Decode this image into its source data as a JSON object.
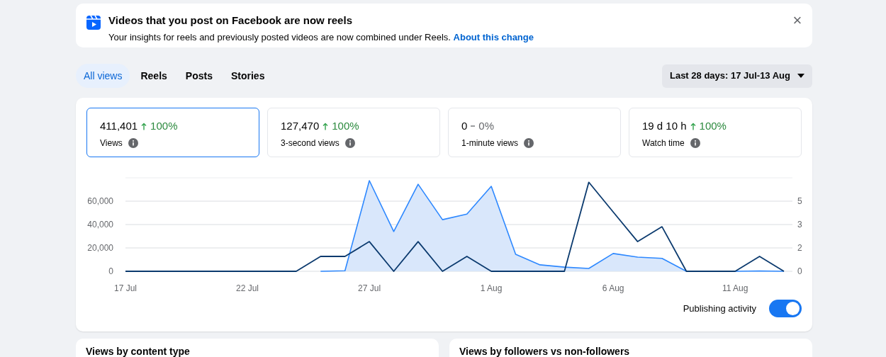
{
  "banner": {
    "title": "Videos that you post on Facebook are now reels",
    "text": "Your insights for reels and previously posted videos are now combined under Reels.",
    "link": "About this change",
    "close": "×"
  },
  "tabs": [
    {
      "label": "All views",
      "selected": true
    },
    {
      "label": "Reels",
      "selected": false
    },
    {
      "label": "Posts",
      "selected": false
    },
    {
      "label": "Stories",
      "selected": false
    }
  ],
  "date_range": {
    "label": "Last 28 days: 17 Jul-13 Aug"
  },
  "metrics": [
    {
      "value": "411,401",
      "kind": "up",
      "change": "100%",
      "label": "Views",
      "selected": true
    },
    {
      "value": "127,470",
      "kind": "up",
      "change": "100%",
      "label": "3-second views",
      "selected": false
    },
    {
      "value": "0",
      "kind": "flat",
      "change": "0%",
      "label": "1-minute views",
      "selected": false
    },
    {
      "value": "19 d 10 h",
      "kind": "up",
      "change": "100%",
      "label": "Watch time",
      "selected": false
    }
  ],
  "chart": {
    "chart_data": {
      "type": "line",
      "categories": [
        "17 Jul",
        null,
        null,
        null,
        null,
        "22 Jul",
        null,
        null,
        null,
        null,
        "27 Jul",
        null,
        null,
        null,
        null,
        "1 Aug",
        null,
        null,
        null,
        null,
        "6 Aug",
        null,
        null,
        null,
        null,
        "11 Aug",
        null,
        null
      ],
      "series": [
        {
          "color": "#2d88ff",
          "values": [
            null,
            null,
            null,
            null,
            null,
            null,
            null,
            null,
            0,
            500,
            77600,
            34000,
            74500,
            44200,
            49000,
            72700,
            14500,
            5500,
            3600,
            2400,
            15200,
            12100,
            11000,
            0,
            0,
            0,
            300,
            0
          ]
        },
        {
          "color": "#0b3a6e",
          "axis": "y2",
          "values": [
            0,
            0,
            0,
            0,
            0,
            0,
            0,
            0,
            1,
            1,
            2,
            0,
            2,
            0,
            1,
            0,
            0,
            0,
            0,
            6,
            4,
            2,
            3,
            0,
            0,
            0,
            1,
            0
          ]
        }
      ],
      "grid": true,
      "ylim": [
        0,
        80000
      ],
      "y2lim": [
        0,
        6.3
      ],
      "yticks": [
        {
          "value": 0,
          "label": "0"
        },
        {
          "value": 20000,
          "label": "20,000"
        },
        {
          "value": 40000,
          "label": "40,000"
        },
        {
          "value": 60000,
          "label": "60,000"
        }
      ],
      "y2ticks": [
        {
          "value": 0,
          "label": "0"
        },
        {
          "value": 1.57,
          "label": "2"
        },
        {
          "value": 3.14,
          "label": "3"
        },
        {
          "value": 4.71,
          "label": "5"
        }
      ]
    },
    "toggle": {
      "label": "Publishing activity",
      "on": true
    }
  },
  "sections": [
    {
      "title": "Views by content type"
    },
    {
      "title": "Views by followers vs non-followers"
    }
  ]
}
